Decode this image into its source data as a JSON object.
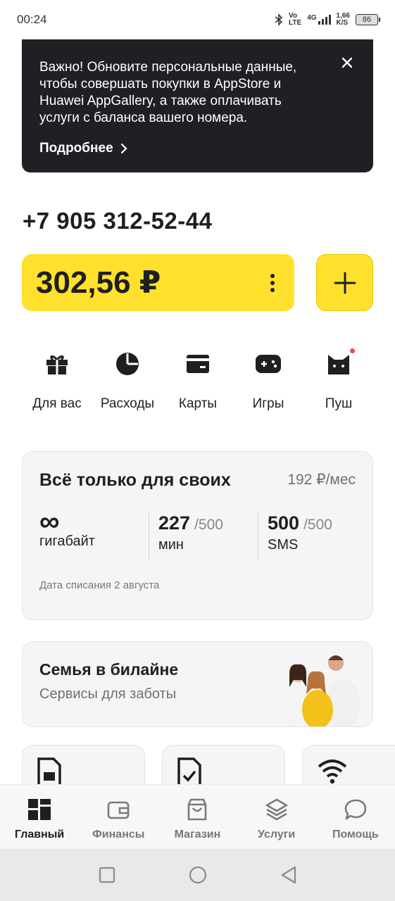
{
  "status_bar": {
    "time": "00:24",
    "network_top": "Vo",
    "network_bottom": "LTE",
    "signal_label": "4G",
    "speed_top": "1,66",
    "speed_bottom": "K/S",
    "battery": "86"
  },
  "notice": {
    "text": "Важно! Обновите персональные данные, чтобы совершать покупки в AppStore и Huawei AppGallery, а также оплачивать услуги с баланса вашего номера.",
    "link_label": "Подробнее"
  },
  "account": {
    "phone": "+7 905 312-52-44",
    "balance": "302,56 ₽"
  },
  "quick_actions": [
    {
      "label": "Для вас",
      "icon": "gift-icon"
    },
    {
      "label": "Расходы",
      "icon": "pie-chart-icon"
    },
    {
      "label": "Карты",
      "icon": "card-icon"
    },
    {
      "label": "Игры",
      "icon": "gamepad-icon"
    },
    {
      "label": "Пуш",
      "icon": "cat-icon"
    }
  ],
  "tariff": {
    "title": "Всё только для своих",
    "price": "192 ₽/мес",
    "internet_value": "∞",
    "internet_unit": "гигабайт",
    "minutes_value": "227",
    "minutes_limit": "/500",
    "minutes_unit": "мин",
    "sms_value": "500",
    "sms_limit": "/500",
    "sms_unit": "SMS",
    "charge_date": "Дата списания 2 августа"
  },
  "family": {
    "title": "Семья в билайне",
    "subtitle": "Сервисы для заботы"
  },
  "tabs": [
    {
      "label": "Главный",
      "icon": "dashboard-icon",
      "active": true
    },
    {
      "label": "Финансы",
      "icon": "wallet-icon",
      "active": false
    },
    {
      "label": "Магазин",
      "icon": "shopping-bag-icon",
      "active": false
    },
    {
      "label": "Услуги",
      "icon": "layers-icon",
      "active": false
    },
    {
      "label": "Помощь",
      "icon": "chat-bubble-icon",
      "active": false
    }
  ],
  "colors": {
    "accent_yellow": "#ffe12d",
    "dark_banner": "#1f2023",
    "notification_red": "#f04a4a"
  }
}
